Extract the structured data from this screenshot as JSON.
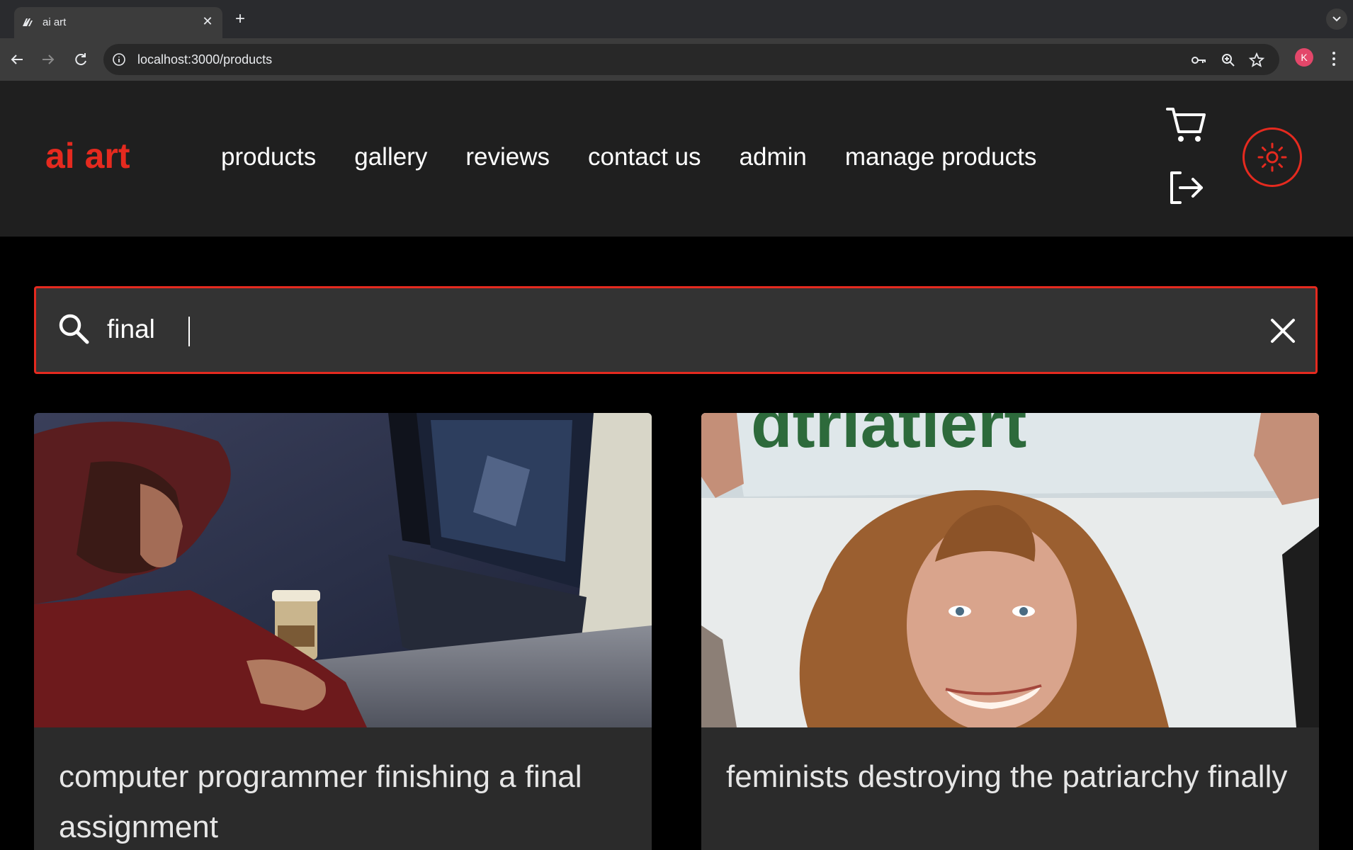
{
  "browser": {
    "tab_title": "ai art",
    "url": "localhost:3000/products",
    "profile_initial": "K"
  },
  "site": {
    "logo": "ai art",
    "nav": [
      "products",
      "gallery",
      "reviews",
      "contact us",
      "admin",
      "manage products"
    ],
    "accent_color": "#e52a1f"
  },
  "search": {
    "value": "final"
  },
  "products": [
    {
      "title": "computer programmer finishing a final assignment",
      "image": "programmer-at-computer"
    },
    {
      "title": "feminists destroying the patriarchy finally",
      "image": "woman-holding-banner"
    }
  ],
  "icons": [
    "search-icon",
    "clear-icon",
    "cart-icon",
    "logout-icon",
    "sun-icon",
    "star-icon",
    "key-icon",
    "zoom-icon"
  ]
}
